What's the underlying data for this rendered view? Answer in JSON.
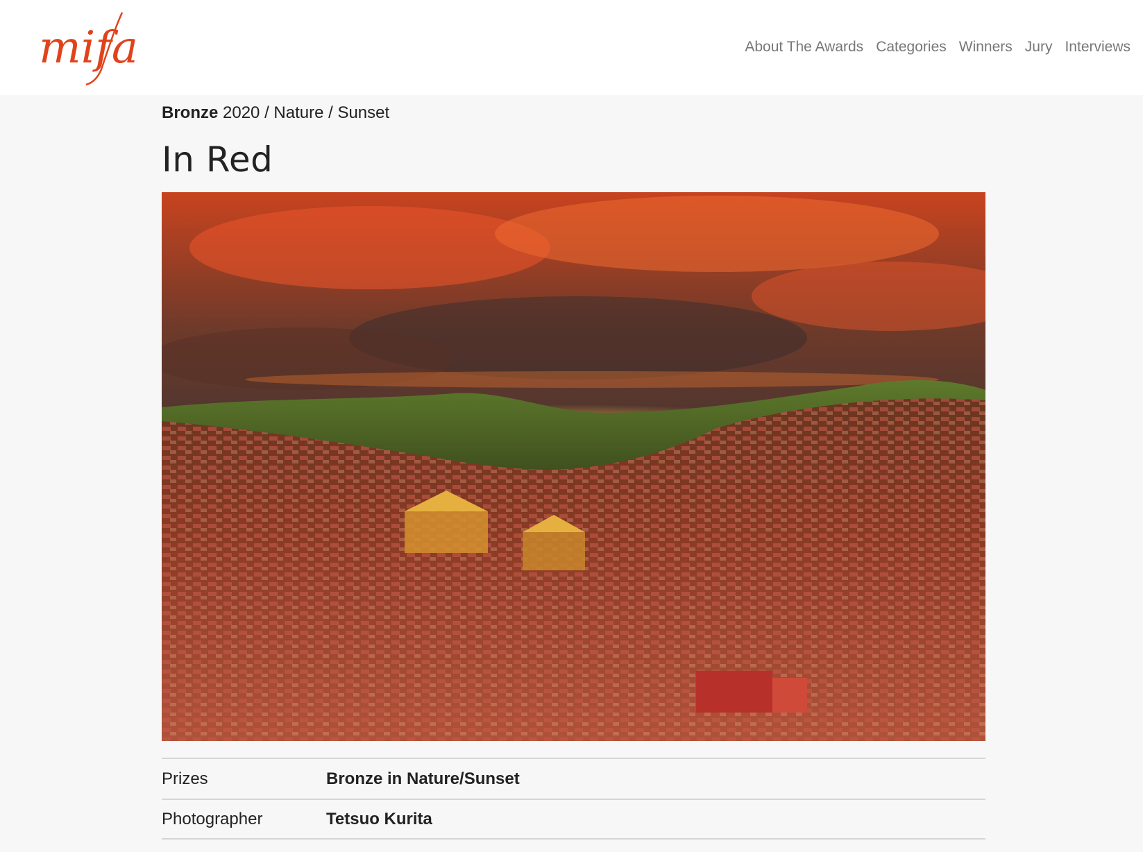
{
  "header": {
    "logo_text": "mifa",
    "nav": [
      {
        "label": "About The Awards"
      },
      {
        "label": "Categories"
      },
      {
        "label": "Winners"
      },
      {
        "label": "Jury"
      },
      {
        "label": "Interviews"
      }
    ]
  },
  "breadcrumb": {
    "prize": "Bronze",
    "path": " 2020 / Nature / Sunset"
  },
  "title": "In Red",
  "photo": {
    "subject": "Sunset over a valley of red monastery houses beneath fiery orange clouds"
  },
  "details": [
    {
      "label": "Prizes",
      "value": "Bronze in Nature/Sunset"
    },
    {
      "label": "Photographer",
      "value": "Tetsuo Kurita"
    }
  ],
  "colors": {
    "logo": "#e0431b",
    "nav": "#777777",
    "background": "#f7f7f7",
    "header": "#ffffff"
  }
}
